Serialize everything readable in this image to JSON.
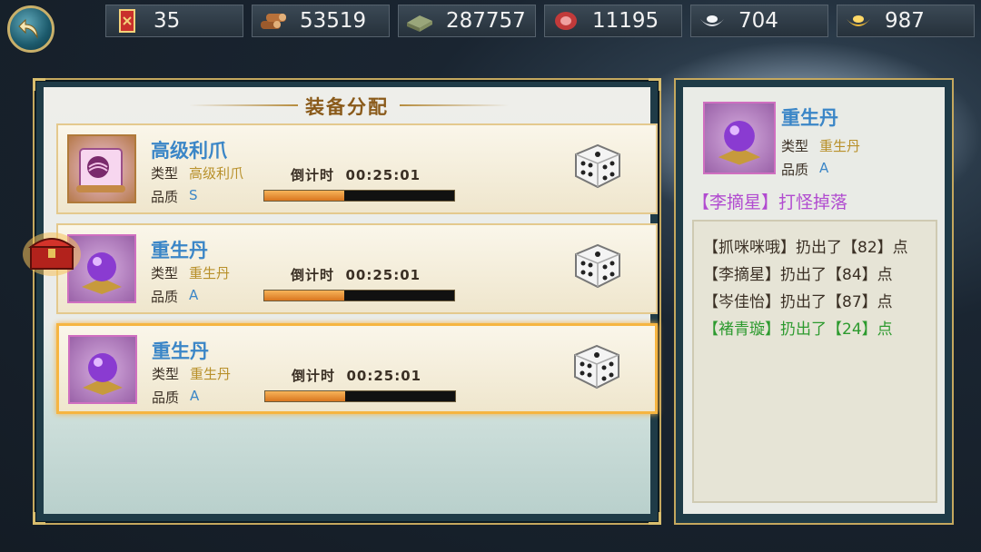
{
  "resources": [
    {
      "icon": "ticket-icon",
      "value": "35"
    },
    {
      "icon": "wood-icon",
      "value": "53519"
    },
    {
      "icon": "stone-icon",
      "value": "287757"
    },
    {
      "icon": "meat-icon",
      "value": "11195"
    },
    {
      "icon": "silver-icon",
      "value": "704"
    },
    {
      "icon": "gold-icon",
      "value": "987"
    }
  ],
  "panel": {
    "title": "装备分配"
  },
  "items": [
    {
      "name": "高级利爪",
      "type_label": "类型",
      "type": "高级利爪",
      "quality_label": "品质",
      "quality": "S",
      "countdown_label": "倒计时",
      "countdown": "00:25:01",
      "progress": 0.42,
      "icon": "scroll-icon"
    },
    {
      "name": "重生丹",
      "type_label": "类型",
      "type": "重生丹",
      "quality_label": "品质",
      "quality": "A",
      "countdown_label": "倒计时",
      "countdown": "00:25:01",
      "progress": 0.42,
      "icon": "purple-orb-icon"
    },
    {
      "name": "重生丹",
      "type_label": "类型",
      "type": "重生丹",
      "quality_label": "品质",
      "quality": "A",
      "countdown_label": "倒计时",
      "countdown": "00:25:01",
      "progress": 0.42,
      "icon": "purple-orb-icon"
    }
  ],
  "detail": {
    "name": "重生丹",
    "type_label": "类型",
    "type": "重生丹",
    "quality_label": "品质",
    "quality": "A",
    "drop_text": "【李摘星】打怪掉落",
    "rolls": [
      {
        "text": "【抓咪咪哦】扔出了【82】点",
        "winner": false
      },
      {
        "text": "【李摘星】扔出了【84】点",
        "winner": false
      },
      {
        "text": "【岑佳怡】扔出了【87】点",
        "winner": false
      },
      {
        "text": "【褚青璇】扔出了【24】点",
        "winner": true
      }
    ]
  },
  "colors": {
    "quality_text": "#3b86c7",
    "type_text": "#b8902a",
    "winner": "#2c9a2e",
    "drop": "#b14bd0"
  }
}
